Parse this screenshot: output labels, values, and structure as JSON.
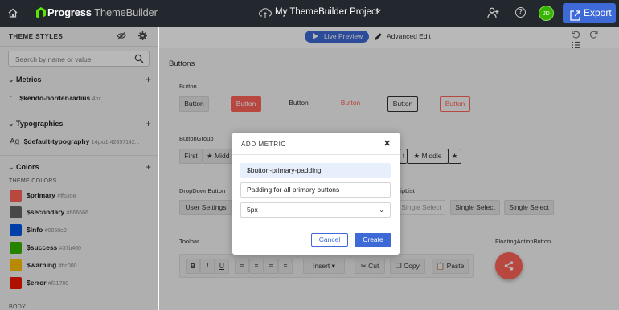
{
  "topbar": {
    "brand_bold": "Progress",
    "brand_light": "ThemeBuilder",
    "project_name": "My ThemeBuilder Project",
    "avatar_initials": "JD",
    "export_label": "Export",
    "help_label": "?"
  },
  "sidebar": {
    "header": "THEME STYLES",
    "search_placeholder": "Search by name or value",
    "groups": {
      "metrics": {
        "title": "Metrics",
        "items": [
          {
            "name": "$kendo-border-radius",
            "value": "4px"
          }
        ]
      },
      "typographies": {
        "title": "Typographies",
        "items": [
          {
            "prefix": "Ag",
            "name": "$default-typography",
            "value": "14px/1.42857142..."
          }
        ]
      },
      "colors": {
        "title": "Colors",
        "subtitle": "THEME COLORS",
        "items": [
          {
            "name": "$primary",
            "value": "#ff6358",
            "color": "#ff6358"
          },
          {
            "name": "$secondary",
            "value": "#666666",
            "color": "#666666"
          },
          {
            "name": "$info",
            "value": "#0058e9",
            "color": "#0058e9"
          },
          {
            "name": "$success",
            "value": "#37b400",
            "color": "#37b400"
          },
          {
            "name": "$warning",
            "value": "#ffc000",
            "color": "#ffc000"
          },
          {
            "name": "$error",
            "value": "#f31700",
            "color": "#f31700"
          }
        ],
        "next_subtitle": "BODY"
      }
    }
  },
  "main": {
    "live_preview_label": "Live Preview",
    "advanced_edit_label": "Advanced Edit",
    "section_title": "Buttons",
    "button_label": "Button",
    "buttons": [
      "Button",
      "Button",
      "Button",
      "Button",
      "Button",
      "Button"
    ],
    "buttongroup_label": "ButtonGroup",
    "buttongroup_items": [
      "First",
      "Midd",
      "t",
      "Middle"
    ],
    "dropdown_label": "DropDownButton",
    "dropdown_value": "User Settings",
    "chiplist_label": "hipList",
    "chips": [
      "Single Select",
      "Single Select",
      "Single Select"
    ],
    "fab_label": "FloatingActionButton",
    "toolbar_label": "Toolbar",
    "toolbar": {
      "bold": "B",
      "italic": "I",
      "underline": "U",
      "insert": "Insert",
      "cut": "Cut",
      "copy": "Copy",
      "paste": "Paste"
    }
  },
  "dialog": {
    "title": "ADD METRIC",
    "name_value": "$button-primary-padding",
    "description_value": "Padding for all primary buttons",
    "value_selected": "5px",
    "cancel_label": "Cancel",
    "create_label": "Create"
  },
  "colors": {
    "accent": "#3d6ad6",
    "primary": "#ff6358",
    "topbar": "#23272e"
  }
}
